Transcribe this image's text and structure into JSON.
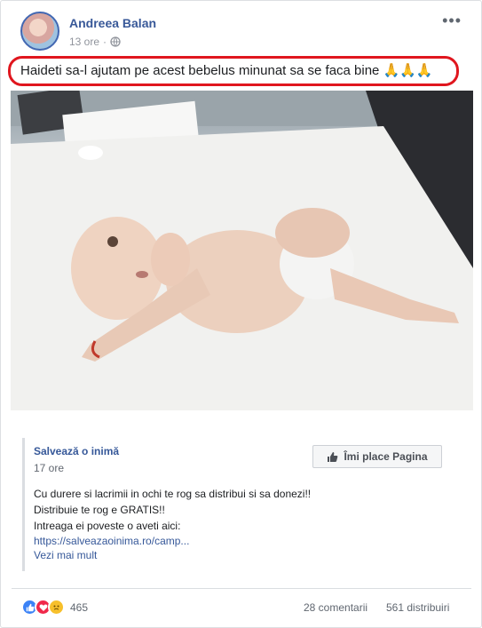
{
  "post": {
    "author": "Andreea Balan",
    "time": "13 ore",
    "separator": "·",
    "more_label": "•••",
    "caption": "Haideti sa-l ajutam pe acest bebelus minunat sa se faca bine",
    "caption_emoji": "🙏🙏🙏",
    "privacy_icon": "globe-icon"
  },
  "shared": {
    "page_name": "Salvează o inimă",
    "time": "17 ore",
    "like_page_label": "Îmi place Pagina",
    "lines": [
      "Cu durere si lacrimii in ochi te rog sa distribui si sa donezi!!",
      "Distribuie te rog e GRATIS!!",
      "Intreaga ei poveste o aveti aici:",
      "https://salveazaoinima.ro/camp..."
    ],
    "see_more": "Vezi mai mult"
  },
  "footer": {
    "reaction_icons": [
      "like-icon",
      "love-icon",
      "sad-icon"
    ],
    "reactions_count": "465",
    "comments": "28 comentarii",
    "shares": "561 distribuiri"
  },
  "colors": {
    "link_blue": "#385898",
    "highlight_red": "#e0161e",
    "muted_gray": "#90949c"
  }
}
